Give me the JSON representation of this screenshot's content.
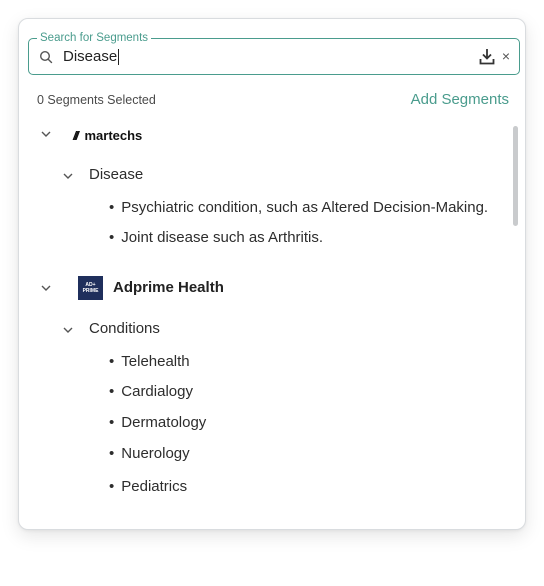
{
  "search": {
    "legend": "Search for Segments",
    "value": "Disease",
    "clear_glyph": "×"
  },
  "selection": {
    "count_text": "0 Segments Selected",
    "add_label": "Add Segments"
  },
  "providers": [
    {
      "name": "martechs",
      "logo_text": "martechs",
      "logo_mark": "///",
      "icon": "martechs-logo",
      "categories": [
        {
          "label": "Disease",
          "items": [
            "Psychiatric condition, such as Altered Decision-Making.",
            "Joint disease such as Arthritis."
          ]
        }
      ]
    },
    {
      "name": "Adprime Health",
      "logo_text": [
        "AD+",
        "PRIME"
      ],
      "icon": "adprime-logo",
      "categories": [
        {
          "label": "Conditions",
          "items": [
            "Telehealth",
            "Cardialogy",
            "Dermatology",
            "Nuerology",
            "Pediatrics"
          ]
        }
      ]
    }
  ],
  "colors": {
    "accent": "#4a9c8d",
    "adprime_logo_bg": "#1f2f5c",
    "martechs_accent": "#d94a3a"
  }
}
